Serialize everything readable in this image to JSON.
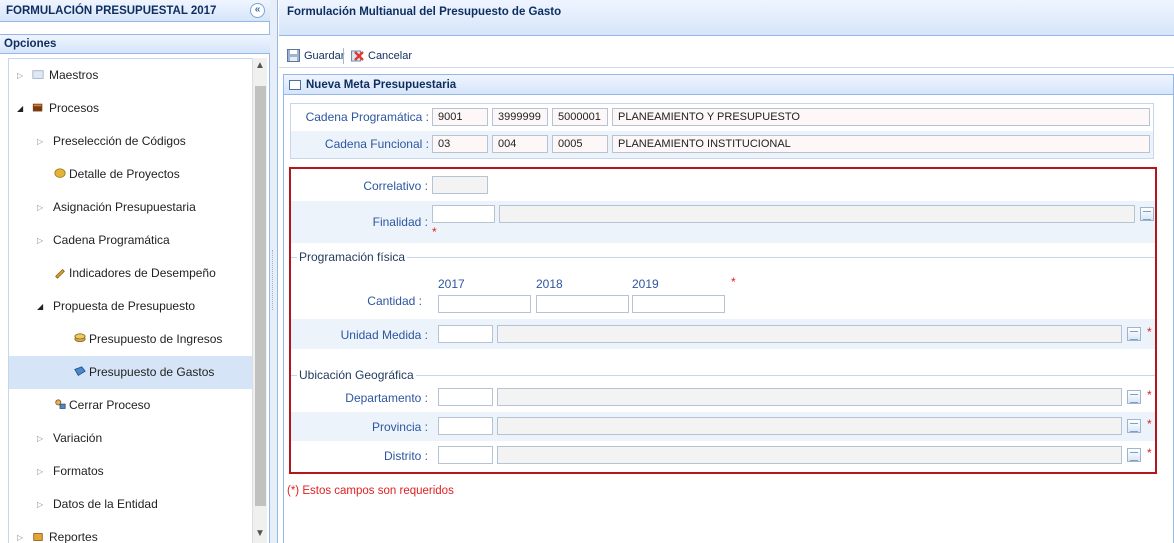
{
  "left_panel": {
    "title": "FORMULACIÓN PRESUPUESTAL 2017",
    "collapse_glyph": "«",
    "options_label": "Opciones",
    "tree": [
      {
        "label": "Maestros",
        "icon": "folder-icon",
        "toggle": "▷",
        "selected": false
      },
      {
        "label": "Procesos",
        "icon": "book-icon",
        "toggle": "◢",
        "selected": false
      },
      {
        "label": "Preselección de Códigos",
        "icon": "",
        "toggle": "▷",
        "selected": false
      },
      {
        "label": "Detalle de Proyectos",
        "icon": "coin-icon",
        "toggle": "",
        "selected": false
      },
      {
        "label": "Asignación Presupuestaria",
        "icon": "",
        "toggle": "▷",
        "selected": false
      },
      {
        "label": "Cadena Programática",
        "icon": "",
        "toggle": "▷",
        "selected": false
      },
      {
        "label": "Indicadores de Desempeño",
        "icon": "pencil-icon",
        "toggle": "",
        "selected": false
      },
      {
        "label": "Propuesta de Presupuesto",
        "icon": "",
        "toggle": "◢",
        "selected": false
      },
      {
        "label": "Presupuesto de Ingresos",
        "icon": "coins-icon",
        "toggle": "",
        "selected": false
      },
      {
        "label": "Presupuesto de Gastos",
        "icon": "wallet-icon",
        "toggle": "",
        "selected": true
      },
      {
        "label": "Cerrar Proceso",
        "icon": "user-lock-icon",
        "toggle": "",
        "selected": false
      },
      {
        "label": "Variación",
        "icon": "",
        "toggle": "▷",
        "selected": false
      },
      {
        "label": "Formatos",
        "icon": "",
        "toggle": "▷",
        "selected": false
      },
      {
        "label": "Datos de la Entidad",
        "icon": "",
        "toggle": "▷",
        "selected": false
      },
      {
        "label": "Reportes",
        "icon": "report-icon",
        "toggle": "▷",
        "selected": false
      }
    ]
  },
  "right_panel": {
    "title": "Formulación Multianual del Presupuesto de Gasto",
    "toolbar": {
      "save_label": "Guardar",
      "cancel_label": "Cancelar"
    },
    "form_title": "Nueva Meta Presupuestaria",
    "cadena_programatica": {
      "label": "Cadena Programática :",
      "v1": "9001",
      "v2": "3999999",
      "v3": "5000001",
      "desc": "PLANEAMIENTO Y PRESUPUESTO"
    },
    "cadena_funcional": {
      "label": "Cadena Funcional :",
      "v1": "03",
      "v2": "004",
      "v3": "0005",
      "desc": "PLANEAMIENTO INSTITUCIONAL"
    },
    "correlativo_label": "Correlativo :",
    "finalidad_label": "Finalidad :",
    "programacion_legend": "Programación física",
    "years": [
      "2017",
      "2018",
      "2019"
    ],
    "cantidad_label": "Cantidad :",
    "unidad_label": "Unidad Medida :",
    "ubicacion_legend": "Ubicación Geográfica",
    "departamento_label": "Departamento :",
    "provincia_label": "Provincia :",
    "distrito_label": "Distrito :",
    "required_mark": "*",
    "required_note": "(*) Estos campos son requeridos"
  }
}
